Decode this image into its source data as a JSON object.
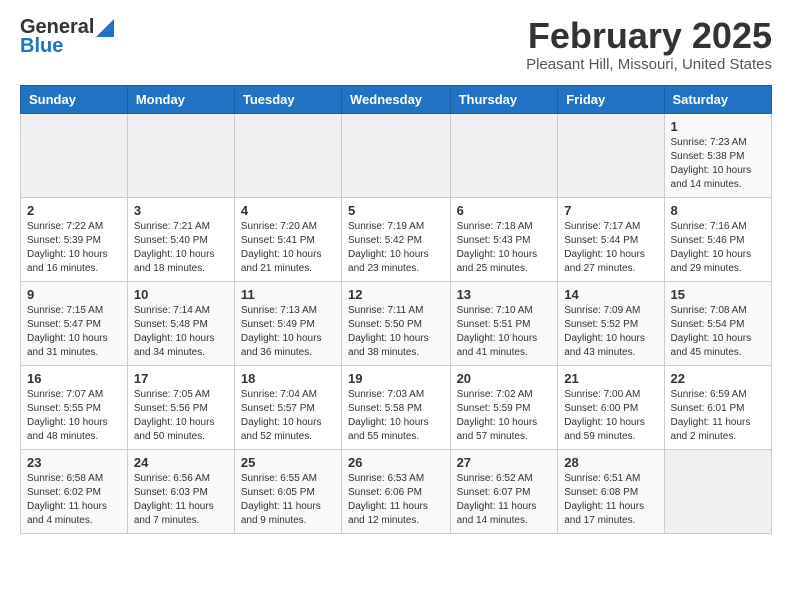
{
  "logo": {
    "general": "General",
    "blue": "Blue"
  },
  "title": "February 2025",
  "subtitle": "Pleasant Hill, Missouri, United States",
  "days_of_week": [
    "Sunday",
    "Monday",
    "Tuesday",
    "Wednesday",
    "Thursday",
    "Friday",
    "Saturday"
  ],
  "weeks": [
    [
      {
        "day": "",
        "info": ""
      },
      {
        "day": "",
        "info": ""
      },
      {
        "day": "",
        "info": ""
      },
      {
        "day": "",
        "info": ""
      },
      {
        "day": "",
        "info": ""
      },
      {
        "day": "",
        "info": ""
      },
      {
        "day": "1",
        "info": "Sunrise: 7:23 AM\nSunset: 5:38 PM\nDaylight: 10 hours and 14 minutes."
      }
    ],
    [
      {
        "day": "2",
        "info": "Sunrise: 7:22 AM\nSunset: 5:39 PM\nDaylight: 10 hours and 16 minutes."
      },
      {
        "day": "3",
        "info": "Sunrise: 7:21 AM\nSunset: 5:40 PM\nDaylight: 10 hours and 18 minutes."
      },
      {
        "day": "4",
        "info": "Sunrise: 7:20 AM\nSunset: 5:41 PM\nDaylight: 10 hours and 21 minutes."
      },
      {
        "day": "5",
        "info": "Sunrise: 7:19 AM\nSunset: 5:42 PM\nDaylight: 10 hours and 23 minutes."
      },
      {
        "day": "6",
        "info": "Sunrise: 7:18 AM\nSunset: 5:43 PM\nDaylight: 10 hours and 25 minutes."
      },
      {
        "day": "7",
        "info": "Sunrise: 7:17 AM\nSunset: 5:44 PM\nDaylight: 10 hours and 27 minutes."
      },
      {
        "day": "8",
        "info": "Sunrise: 7:16 AM\nSunset: 5:46 PM\nDaylight: 10 hours and 29 minutes."
      }
    ],
    [
      {
        "day": "9",
        "info": "Sunrise: 7:15 AM\nSunset: 5:47 PM\nDaylight: 10 hours and 31 minutes."
      },
      {
        "day": "10",
        "info": "Sunrise: 7:14 AM\nSunset: 5:48 PM\nDaylight: 10 hours and 34 minutes."
      },
      {
        "day": "11",
        "info": "Sunrise: 7:13 AM\nSunset: 5:49 PM\nDaylight: 10 hours and 36 minutes."
      },
      {
        "day": "12",
        "info": "Sunrise: 7:11 AM\nSunset: 5:50 PM\nDaylight: 10 hours and 38 minutes."
      },
      {
        "day": "13",
        "info": "Sunrise: 7:10 AM\nSunset: 5:51 PM\nDaylight: 10 hours and 41 minutes."
      },
      {
        "day": "14",
        "info": "Sunrise: 7:09 AM\nSunset: 5:52 PM\nDaylight: 10 hours and 43 minutes."
      },
      {
        "day": "15",
        "info": "Sunrise: 7:08 AM\nSunset: 5:54 PM\nDaylight: 10 hours and 45 minutes."
      }
    ],
    [
      {
        "day": "16",
        "info": "Sunrise: 7:07 AM\nSunset: 5:55 PM\nDaylight: 10 hours and 48 minutes."
      },
      {
        "day": "17",
        "info": "Sunrise: 7:05 AM\nSunset: 5:56 PM\nDaylight: 10 hours and 50 minutes."
      },
      {
        "day": "18",
        "info": "Sunrise: 7:04 AM\nSunset: 5:57 PM\nDaylight: 10 hours and 52 minutes."
      },
      {
        "day": "19",
        "info": "Sunrise: 7:03 AM\nSunset: 5:58 PM\nDaylight: 10 hours and 55 minutes."
      },
      {
        "day": "20",
        "info": "Sunrise: 7:02 AM\nSunset: 5:59 PM\nDaylight: 10 hours and 57 minutes."
      },
      {
        "day": "21",
        "info": "Sunrise: 7:00 AM\nSunset: 6:00 PM\nDaylight: 10 hours and 59 minutes."
      },
      {
        "day": "22",
        "info": "Sunrise: 6:59 AM\nSunset: 6:01 PM\nDaylight: 11 hours and 2 minutes."
      }
    ],
    [
      {
        "day": "23",
        "info": "Sunrise: 6:58 AM\nSunset: 6:02 PM\nDaylight: 11 hours and 4 minutes."
      },
      {
        "day": "24",
        "info": "Sunrise: 6:56 AM\nSunset: 6:03 PM\nDaylight: 11 hours and 7 minutes."
      },
      {
        "day": "25",
        "info": "Sunrise: 6:55 AM\nSunset: 6:05 PM\nDaylight: 11 hours and 9 minutes."
      },
      {
        "day": "26",
        "info": "Sunrise: 6:53 AM\nSunset: 6:06 PM\nDaylight: 11 hours and 12 minutes."
      },
      {
        "day": "27",
        "info": "Sunrise: 6:52 AM\nSunset: 6:07 PM\nDaylight: 11 hours and 14 minutes."
      },
      {
        "day": "28",
        "info": "Sunrise: 6:51 AM\nSunset: 6:08 PM\nDaylight: 11 hours and 17 minutes."
      },
      {
        "day": "",
        "info": ""
      }
    ]
  ]
}
